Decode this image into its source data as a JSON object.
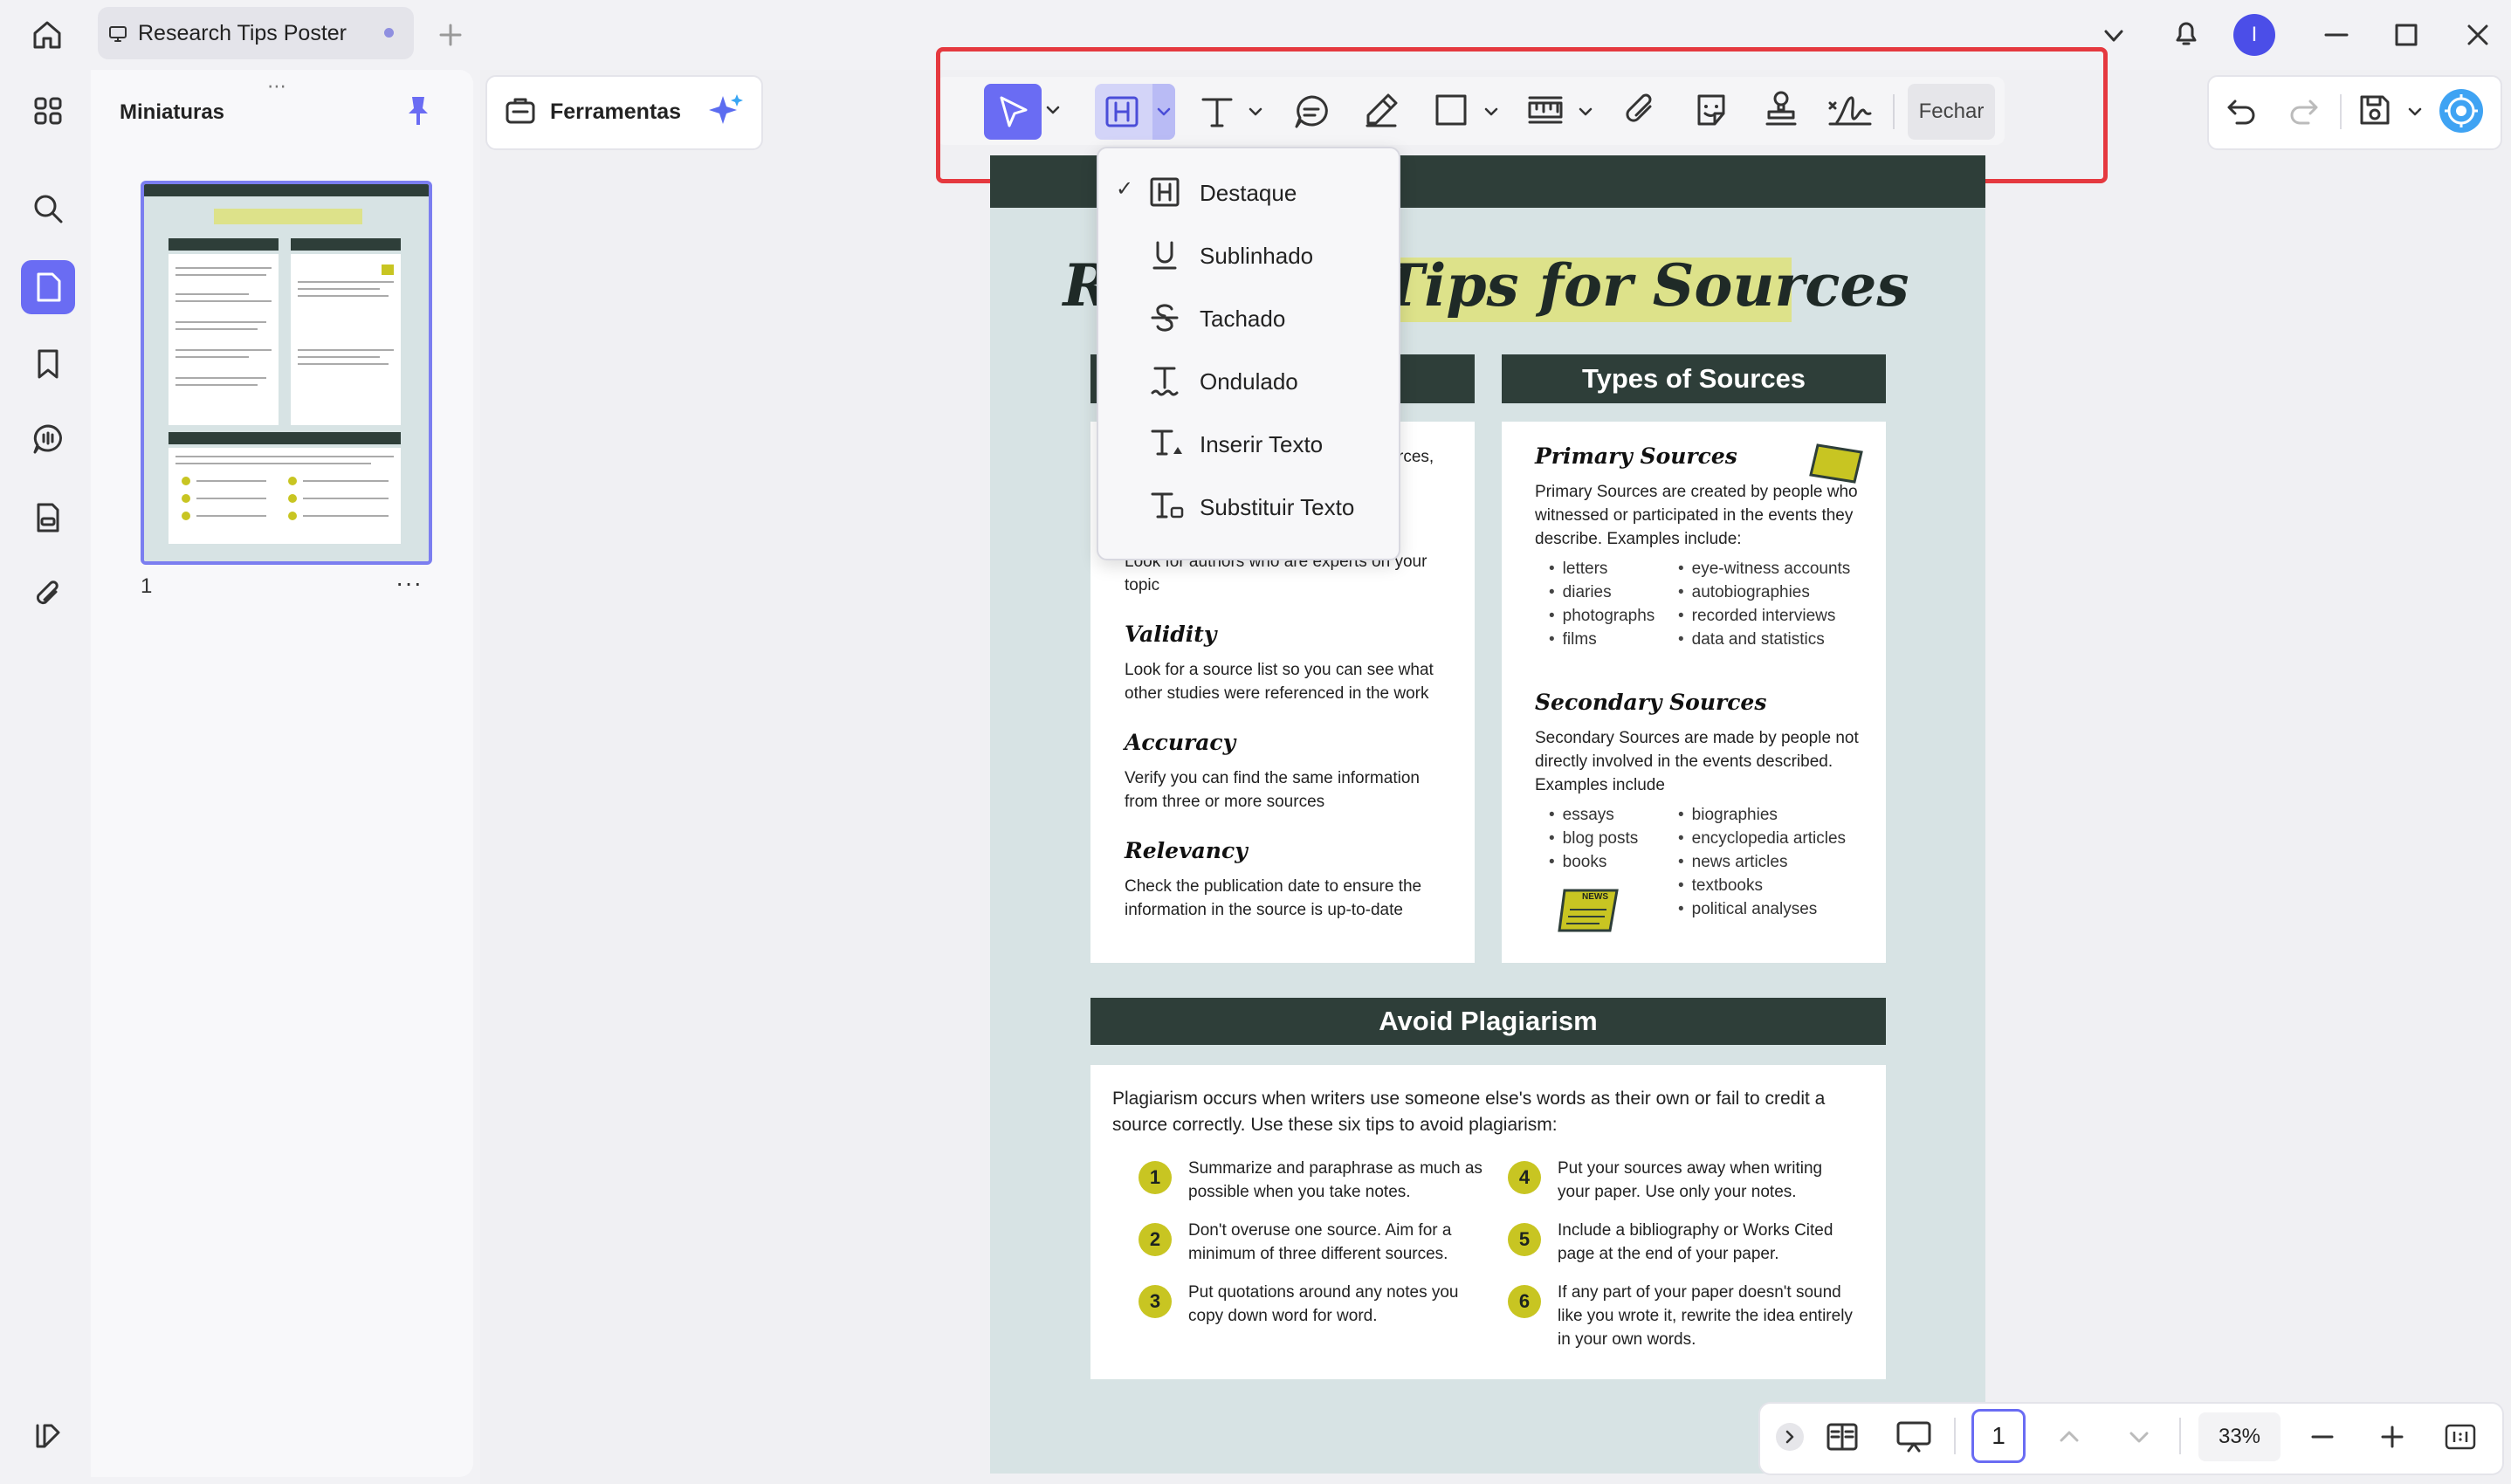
{
  "tab": {
    "title": "Research Tips Poster"
  },
  "user": {
    "avatar_letter": "I"
  },
  "thumbnails": {
    "title": "Miniaturas",
    "page_number": "1"
  },
  "tools": {
    "label": "Ferramentas"
  },
  "toolbar": {
    "close_label": "Fechar"
  },
  "dropdown": {
    "items": [
      {
        "label": "Destaque",
        "checked": true
      },
      {
        "label": "Sublinhado"
      },
      {
        "label": "Tachado"
      },
      {
        "label": "Ondulado"
      },
      {
        "label": "Inserir Texto"
      },
      {
        "label": "Substituir Texto"
      }
    ]
  },
  "poster": {
    "title": "Research Tips for Sources",
    "left_panel": {
      "partial_line": "rces,",
      "authority_text": "Look for authors who are experts on your topic",
      "sections": [
        {
          "head": "Validity",
          "text": "Look for a source list so you can see what other studies were referenced in the work"
        },
        {
          "head": "Accuracy",
          "text": "Verify you can find the same information from three or more sources"
        },
        {
          "head": "Relevancy",
          "text": "Check the publication date to ensure the information in the source is up-to-date"
        }
      ]
    },
    "right_panel": {
      "header": "Types of Sources",
      "primary": {
        "head": "Primary Sources",
        "text": "Primary Sources are created by people who witnessed or participated in the events they describe. Examples include:",
        "col1": [
          "letters",
          "diaries",
          "photographs",
          "films"
        ],
        "col2": [
          "eye-witness accounts",
          "autobiographies",
          "recorded interviews",
          "data and statistics"
        ]
      },
      "secondary": {
        "head": "Secondary Sources",
        "text": "Secondary Sources are made by people not directly involved in the events described. Examples include",
        "col1": [
          "essays",
          "blog posts",
          "books"
        ],
        "col2": [
          "biographies",
          "encyclopedia articles",
          "news articles",
          "textbooks",
          "political analyses"
        ]
      },
      "news_label": "NEWS"
    },
    "plagiarism": {
      "header": "Avoid Plagiarism",
      "intro": "Plagiarism occurs when writers use someone else's words as their own or fail to credit a source correctly. Use these six tips to avoid plagiarism:",
      "tips": [
        {
          "n": "1",
          "text": "Summarize and paraphrase as much as possible when you take notes."
        },
        {
          "n": "2",
          "text": "Don't overuse one source. Aim for a minimum of three different sources."
        },
        {
          "n": "3",
          "text": "Put quotations around any notes you copy down word for word."
        },
        {
          "n": "4",
          "text": "Put your sources away when writing your paper. Use only your notes."
        },
        {
          "n": "5",
          "text": "Include a bibliography or Works Cited page at the end of your paper."
        },
        {
          "n": "6",
          "text": "If any part of your paper doesn't sound like you wrote it, rewrite the idea entirely in your own words."
        }
      ]
    }
  },
  "bottom": {
    "page": "1",
    "zoom": "33%"
  },
  "colors": {
    "accent": "#6a6cf3",
    "header": "#2e3e39",
    "highlight": "#dde28a",
    "frame": "#e5393f"
  }
}
